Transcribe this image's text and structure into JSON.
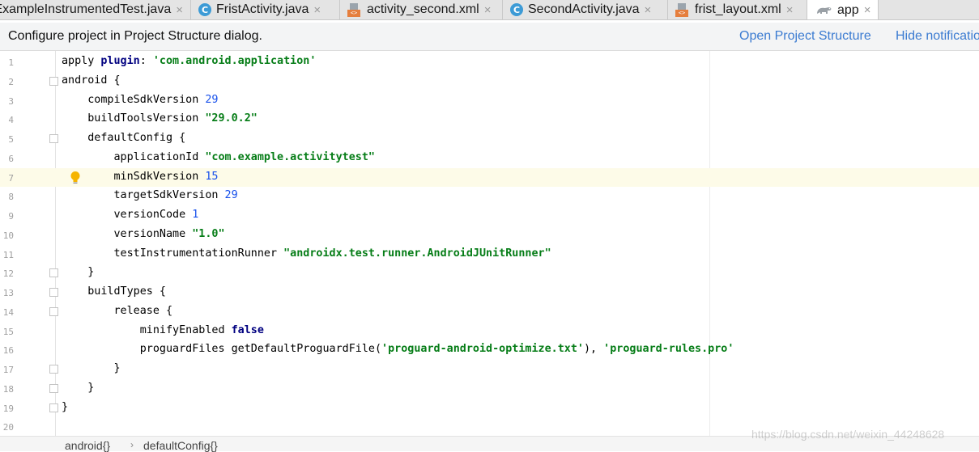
{
  "tabs": [
    {
      "label": "ExampleInstrumentedTest.java",
      "icon": "class-icon",
      "active": false
    },
    {
      "label": "FristActivity.java",
      "icon": "class-icon",
      "active": false
    },
    {
      "label": "activity_second.xml",
      "icon": "xml-file-icon",
      "active": false
    },
    {
      "label": "SecondActivity.java",
      "icon": "class-icon",
      "active": false
    },
    {
      "label": "frist_layout.xml",
      "icon": "xml-file-icon",
      "active": false
    },
    {
      "label": "app",
      "icon": "gradle-icon",
      "active": true
    }
  ],
  "tab_close_glyph": "×",
  "class_icon_glyph": "C",
  "xml_badge_glyph": "<>",
  "notification": {
    "message": "Configure project in Project Structure dialog.",
    "open_link": "Open Project Structure",
    "hide_link": "Hide notification"
  },
  "editor": {
    "current_line": 7,
    "lines": [
      {
        "n": "1",
        "code": "apply plugin: 'com.android.application'"
      },
      {
        "n": "2",
        "code": "android {"
      },
      {
        "n": "3",
        "code": "    compileSdkVersion 29"
      },
      {
        "n": "4",
        "code": "    buildToolsVersion \"29.0.2\""
      },
      {
        "n": "5",
        "code": "    defaultConfig {"
      },
      {
        "n": "6",
        "code": "        applicationId \"com.example.activitytest\""
      },
      {
        "n": "7",
        "code": "        minSdkVersion 15"
      },
      {
        "n": "8",
        "code": "        targetSdkVersion 29"
      },
      {
        "n": "9",
        "code": "        versionCode 1"
      },
      {
        "n": "10",
        "code": "        versionName \"1.0\""
      },
      {
        "n": "11",
        "code": "        testInstrumentationRunner \"androidx.test.runner.AndroidJUnitRunner\""
      },
      {
        "n": "12",
        "code": "    }"
      },
      {
        "n": "13",
        "code": "    buildTypes {"
      },
      {
        "n": "14",
        "code": "        release {"
      },
      {
        "n": "15",
        "code": "            minifyEnabled false"
      },
      {
        "n": "16",
        "code": "            proguardFiles getDefaultProguardFile('proguard-android-optimize.txt'), 'proguard-rules.pro'"
      },
      {
        "n": "17",
        "code": "        }"
      },
      {
        "n": "18",
        "code": "    }"
      },
      {
        "n": "19",
        "code": "}"
      },
      {
        "n": "20",
        "code": ""
      }
    ]
  },
  "breadcrumb": {
    "items": [
      "android{}",
      "defaultConfig{}"
    ],
    "separator": "›"
  },
  "watermark": "https://blog.csdn.net/weixin_44248628",
  "colors": {
    "keyword": "#000080",
    "string": "#067d17",
    "number": "#1750eb",
    "link": "#3b7bd1",
    "current_line": "#fdfbe8",
    "class_icon": "#3d9bd6",
    "xml_badge": "#e57e3d"
  }
}
